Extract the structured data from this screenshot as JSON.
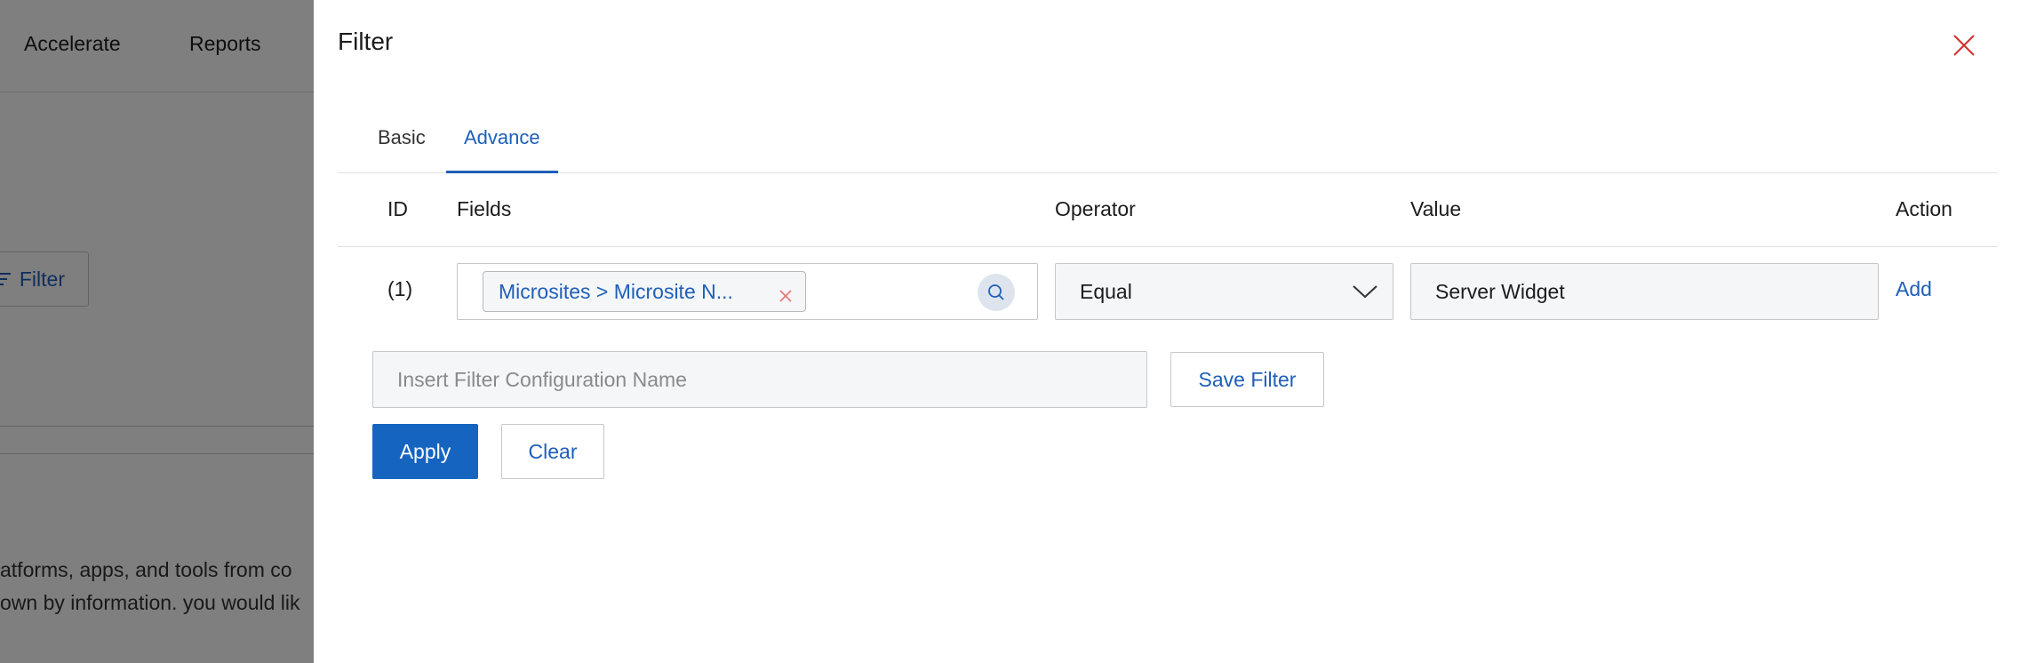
{
  "background": {
    "nav": [
      "Accelerate",
      "Reports"
    ],
    "filter_button_label": "Filter",
    "text_line_1": "atforms, apps, and tools from co",
    "text_line_2": "own by information. you would lik"
  },
  "drawer": {
    "title": "Filter",
    "close_icon": "close-icon"
  },
  "tabs": [
    {
      "label": "Basic",
      "active": false
    },
    {
      "label": "Advance",
      "active": true
    }
  ],
  "table": {
    "headers": {
      "id": "ID",
      "fields": "Fields",
      "operator": "Operator",
      "value": "Value",
      "action": "Action"
    },
    "rows": [
      {
        "id": "(1)",
        "field_tag": "Microsites > Microsite N...",
        "operator": "Equal",
        "value": "Server Widget",
        "action": "Add"
      }
    ]
  },
  "config": {
    "placeholder": "Insert Filter Configuration Name",
    "value": "",
    "save_label": "Save Filter"
  },
  "buttons": {
    "apply": "Apply",
    "clear": "Clear"
  },
  "colors": {
    "accent": "#1f5fb8",
    "primary_button": "#1565c0",
    "close_icon": "#d32f2f",
    "tag_close": "#e57373"
  }
}
